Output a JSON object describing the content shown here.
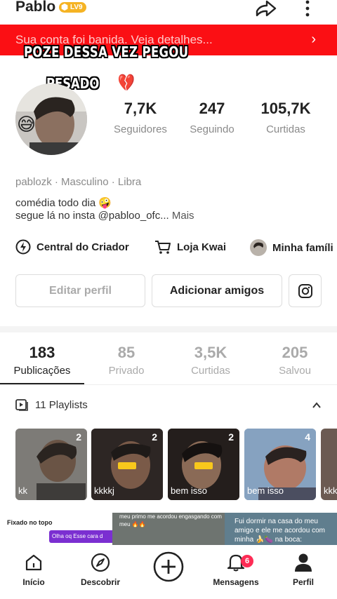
{
  "header": {
    "username": "Pablo",
    "level_badge": "LV9",
    "share_icon": "share-arrow-icon",
    "more_icon": "more-vertical-icon"
  },
  "ban_banner": {
    "text": "Sua conta foi banida. Veja detalhes...",
    "chevron": "›",
    "color": "#fb0f14"
  },
  "overlay": {
    "line1": "POZE DESSA VEZ PEGOU",
    "line2": "PESADO",
    "line2_emoji": "😔💔"
  },
  "avatar": {
    "emoji": "😅"
  },
  "stats": [
    {
      "value": "7,7K",
      "label": "Seguidores"
    },
    {
      "value": "247",
      "label": "Seguindo"
    },
    {
      "value": "105,7K",
      "label": "Curtidas"
    }
  ],
  "profile": {
    "meta": "pablozk · Masculino · Libra",
    "bio_line1": "comédia todo dia 🤪",
    "bio_line2": "segue lá no insta @pabloo_ofc...",
    "bio_more": "Mais"
  },
  "shortcuts": [
    {
      "label": "Central do Criador",
      "icon": "lightning-icon"
    },
    {
      "label": "Loja Kwai",
      "icon": "cart-icon"
    },
    {
      "label": "Minha famíli",
      "icon": "family-avatar-icon"
    }
  ],
  "buttons": {
    "edit": "Editar perfil",
    "add_friends": "Adicionar amigos",
    "instagram_icon": "instagram-icon"
  },
  "tabs": [
    {
      "value": "183",
      "label": "Publicações",
      "active": true
    },
    {
      "value": "85",
      "label": "Privado",
      "active": false
    },
    {
      "value": "3,5K",
      "label": "Curtidas",
      "active": false
    },
    {
      "value": "205",
      "label": "Salvou",
      "active": false
    }
  ],
  "playlists": {
    "label": "11 Playlists",
    "chevron": "^",
    "items": [
      {
        "count": "2",
        "caption": "kk"
      },
      {
        "count": "2",
        "caption": "kkkkj"
      },
      {
        "count": "2",
        "caption": "bem isso"
      },
      {
        "count": "4",
        "caption": "bem isso"
      },
      {
        "count": "",
        "caption": "kkk"
      }
    ]
  },
  "pinned": {
    "label": "Fixado no topo",
    "chat_text": "Olha oq Esse cara d",
    "video2_text": "meu primo me acordou engasgando com meu 🔥🔥",
    "video3_text": "Fui dormir na casa do meu amigo e ele me acordou com minha 🍌🍆 na boca:"
  },
  "bottom_nav": [
    {
      "label": "Início",
      "icon": "home-icon"
    },
    {
      "label": "Descobrir",
      "icon": "compass-icon"
    },
    {
      "label": "",
      "icon": "plus-circle-icon"
    },
    {
      "label": "Mensagens",
      "icon": "bell-icon",
      "badge": "6"
    },
    {
      "label": "Perfil",
      "icon": "person-icon"
    }
  ]
}
